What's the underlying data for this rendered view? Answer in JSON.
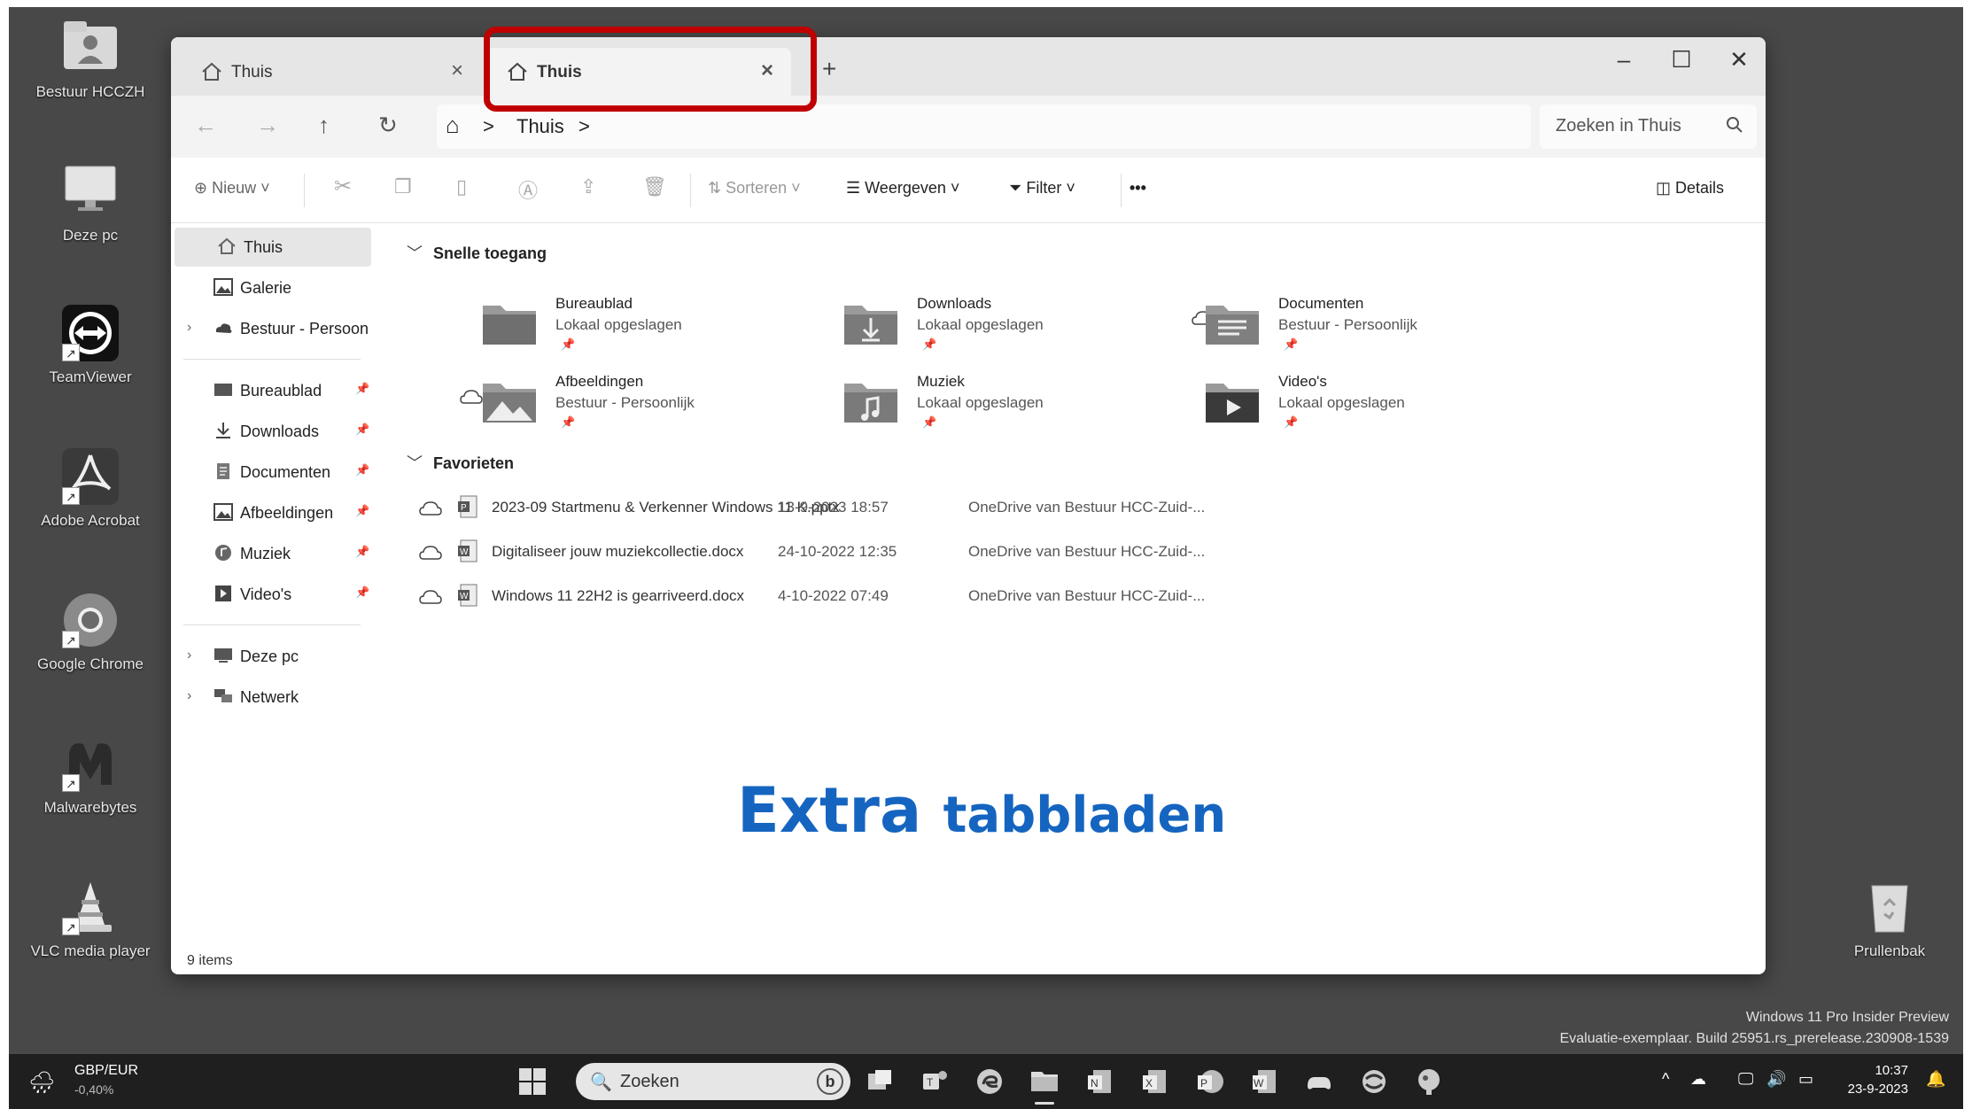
{
  "desktop": {
    "icons": [
      {
        "label": "Bestuur HCCZH",
        "icon": "user-folder-icon"
      },
      {
        "label": "Deze pc",
        "icon": "monitor-icon"
      },
      {
        "label": "TeamViewer",
        "icon": "teamviewer-icon"
      },
      {
        "label": "Adobe Acrobat",
        "icon": "acrobat-icon"
      },
      {
        "label": "Google Chrome",
        "icon": "chrome-icon"
      },
      {
        "label": "Malwarebytes",
        "icon": "malwarebytes-icon"
      },
      {
        "label": "VLC media player",
        "icon": "vlc-icon"
      },
      {
        "label": "Prullenbak",
        "icon": "recycle-bin-icon"
      }
    ],
    "watermark": {
      "line1": "Windows 11 Pro Insider Preview",
      "line2": "Evaluatie-exemplaar. Build 25951.rs_prerelease.230908-1539"
    }
  },
  "explorer": {
    "tabs": [
      {
        "label": "Thuis",
        "active": false
      },
      {
        "label": "Thuis",
        "active": true
      }
    ],
    "new_tab": "+",
    "window_controls": {
      "minimize": "–",
      "maximize": "☐",
      "close": "✕"
    },
    "nav": {
      "back": "←",
      "forward": "→",
      "up": "↑",
      "refresh": "↻"
    },
    "breadcrumb": {
      "home": "⌂",
      "sep": ">",
      "location": "Thuis"
    },
    "search": {
      "placeholder": "Zoeken in Thuis"
    },
    "commands": {
      "new": "Nieuw",
      "sort": "Sorteren",
      "view": "Weergeven",
      "filter": "Filter",
      "more": "•••",
      "details": "Details"
    },
    "sidebar": {
      "top": [
        {
          "label": "Thuis",
          "icon": "home-icon"
        },
        {
          "label": "Galerie",
          "icon": "gallery-icon"
        },
        {
          "label": "Bestuur - Persoonlijk",
          "icon": "onedrive-icon"
        }
      ],
      "pinned": [
        {
          "label": "Bureaublad",
          "icon": "desktop-folder-icon"
        },
        {
          "label": "Downloads",
          "icon": "download-icon"
        },
        {
          "label": "Documenten",
          "icon": "documents-icon"
        },
        {
          "label": "Afbeeldingen",
          "icon": "pictures-icon"
        },
        {
          "label": "Muziek",
          "icon": "music-icon"
        },
        {
          "label": "Video's",
          "icon": "video-icon"
        }
      ],
      "bottom": [
        {
          "label": "Deze pc",
          "icon": "pc-icon"
        },
        {
          "label": "Netwerk",
          "icon": "network-icon"
        }
      ]
    },
    "quick_access": {
      "title": "Snelle toegang",
      "items": [
        {
          "name": "Bureaublad",
          "sub": "Lokaal opgeslagen",
          "cloud": false
        },
        {
          "name": "Downloads",
          "sub": "Lokaal opgeslagen",
          "cloud": false
        },
        {
          "name": "Documenten",
          "sub": "Bestuur - Persoonlijk",
          "cloud": true
        },
        {
          "name": "Afbeeldingen",
          "sub": "Bestuur - Persoonlijk",
          "cloud": true
        },
        {
          "name": "Muziek",
          "sub": "Lokaal opgeslagen",
          "cloud": false
        },
        {
          "name": "Video's",
          "sub": "Lokaal opgeslagen",
          "cloud": false
        }
      ]
    },
    "favorites": {
      "title": "Favorieten",
      "files": [
        {
          "name": "2023-09 Startmenu & Verkenner Windows 11 K.pptx",
          "date": "13-9-2023 18:57",
          "location": "OneDrive van Bestuur HCC-Zuid-..."
        },
        {
          "name": "Digitaliseer jouw muziekcollectie.docx",
          "date": "24-10-2022 12:35",
          "location": "OneDrive van Bestuur HCC-Zuid-..."
        },
        {
          "name": "Windows 11 22H2 is gearriveerd.docx",
          "date": "4-10-2022 07:49",
          "location": "OneDrive van Bestuur HCC-Zuid-..."
        }
      ]
    },
    "status": "9 items"
  },
  "caption": {
    "big": "Extra",
    "small": "tabbladen",
    "color": "#1565c0"
  },
  "highlight_color": "#c00000",
  "taskbar": {
    "ticker": {
      "symbol": "GBP/EUR",
      "change": "-0,40%"
    },
    "search_label": "Zoeken",
    "clock": {
      "time": "10:37",
      "date": "23-9-2023"
    }
  }
}
